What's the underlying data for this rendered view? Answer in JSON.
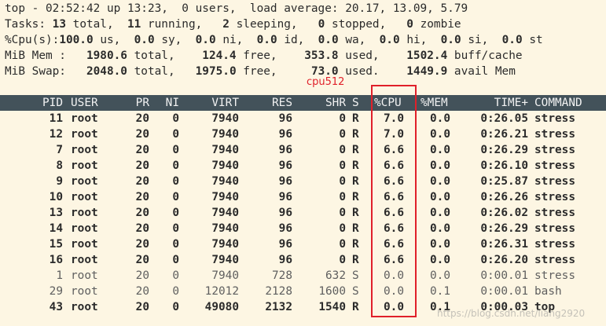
{
  "summary": {
    "line1": "top - 02:52:42 up 13:23,  0 users,  load average: 20.17, 13.09, 5.79",
    "tasks": {
      "label": "Tasks:",
      "total": "13",
      "total_lbl": "total,",
      "running": "11",
      "running_lbl": "running,",
      "sleeping": "2",
      "sleeping_lbl": "sleeping,",
      "stopped": "0",
      "stopped_lbl": "stopped,",
      "zombie": "0",
      "zombie_lbl": "zombie"
    },
    "cpu": {
      "label": "%Cpu(s):",
      "us": "100.0",
      "us_lbl": "us,",
      "sy": "0.0",
      "sy_lbl": "sy,",
      "ni": "0.0",
      "ni_lbl": "ni,",
      "id": "0.0",
      "id_lbl": "id,",
      "wa": "0.0",
      "wa_lbl": "wa,",
      "hi": "0.0",
      "hi_lbl": "hi,",
      "si": "0.0",
      "si_lbl": "si,",
      "st": "0.0",
      "st_lbl": "st"
    },
    "mem": {
      "label": "MiB Mem :",
      "total": "1980.6",
      "total_lbl": "total,",
      "free": "124.4",
      "free_lbl": "free,",
      "used": "353.8",
      "used_lbl": "used,",
      "buff": "1502.4",
      "buff_lbl": "buff/cache"
    },
    "swap": {
      "label": "MiB Swap:",
      "total": "2048.0",
      "total_lbl": "total,",
      "free": "1975.0",
      "free_lbl": "free,",
      "used": "73.0",
      "used_lbl": "used.",
      "avail": "1449.9",
      "avail_lbl": "avail Mem"
    }
  },
  "annotation": "cpu512",
  "columns": [
    "PID",
    "USER",
    "PR",
    "NI",
    "VIRT",
    "RES",
    "SHR",
    "S",
    "%CPU",
    "%MEM",
    "TIME+",
    "COMMAND"
  ],
  "processes": [
    {
      "pid": "11",
      "user": "root",
      "pr": "20",
      "ni": "0",
      "virt": "7940",
      "res": "96",
      "shr": "0",
      "s": "R",
      "cpu": "7.0",
      "mem": "0.0",
      "time": "0:26.05",
      "cmd": "stress",
      "bold": true
    },
    {
      "pid": "12",
      "user": "root",
      "pr": "20",
      "ni": "0",
      "virt": "7940",
      "res": "96",
      "shr": "0",
      "s": "R",
      "cpu": "7.0",
      "mem": "0.0",
      "time": "0:26.21",
      "cmd": "stress",
      "bold": true
    },
    {
      "pid": "7",
      "user": "root",
      "pr": "20",
      "ni": "0",
      "virt": "7940",
      "res": "96",
      "shr": "0",
      "s": "R",
      "cpu": "6.6",
      "mem": "0.0",
      "time": "0:26.29",
      "cmd": "stress",
      "bold": true
    },
    {
      "pid": "8",
      "user": "root",
      "pr": "20",
      "ni": "0",
      "virt": "7940",
      "res": "96",
      "shr": "0",
      "s": "R",
      "cpu": "6.6",
      "mem": "0.0",
      "time": "0:26.10",
      "cmd": "stress",
      "bold": true
    },
    {
      "pid": "9",
      "user": "root",
      "pr": "20",
      "ni": "0",
      "virt": "7940",
      "res": "96",
      "shr": "0",
      "s": "R",
      "cpu": "6.6",
      "mem": "0.0",
      "time": "0:25.87",
      "cmd": "stress",
      "bold": true
    },
    {
      "pid": "10",
      "user": "root",
      "pr": "20",
      "ni": "0",
      "virt": "7940",
      "res": "96",
      "shr": "0",
      "s": "R",
      "cpu": "6.6",
      "mem": "0.0",
      "time": "0:26.26",
      "cmd": "stress",
      "bold": true
    },
    {
      "pid": "13",
      "user": "root",
      "pr": "20",
      "ni": "0",
      "virt": "7940",
      "res": "96",
      "shr": "0",
      "s": "R",
      "cpu": "6.6",
      "mem": "0.0",
      "time": "0:26.02",
      "cmd": "stress",
      "bold": true
    },
    {
      "pid": "14",
      "user": "root",
      "pr": "20",
      "ni": "0",
      "virt": "7940",
      "res": "96",
      "shr": "0",
      "s": "R",
      "cpu": "6.6",
      "mem": "0.0",
      "time": "0:26.29",
      "cmd": "stress",
      "bold": true
    },
    {
      "pid": "15",
      "user": "root",
      "pr": "20",
      "ni": "0",
      "virt": "7940",
      "res": "96",
      "shr": "0",
      "s": "R",
      "cpu": "6.6",
      "mem": "0.0",
      "time": "0:26.31",
      "cmd": "stress",
      "bold": true
    },
    {
      "pid": "16",
      "user": "root",
      "pr": "20",
      "ni": "0",
      "virt": "7940",
      "res": "96",
      "shr": "0",
      "s": "R",
      "cpu": "6.6",
      "mem": "0.0",
      "time": "0:26.20",
      "cmd": "stress",
      "bold": true
    },
    {
      "pid": "1",
      "user": "root",
      "pr": "20",
      "ni": "0",
      "virt": "7940",
      "res": "728",
      "shr": "632",
      "s": "S",
      "cpu": "0.0",
      "mem": "0.0",
      "time": "0:00.01",
      "cmd": "stress",
      "bold": false
    },
    {
      "pid": "29",
      "user": "root",
      "pr": "20",
      "ni": "0",
      "virt": "12012",
      "res": "2128",
      "shr": "1600",
      "s": "S",
      "cpu": "0.0",
      "mem": "0.1",
      "time": "0:00.01",
      "cmd": "bash",
      "bold": false
    },
    {
      "pid": "43",
      "user": "root",
      "pr": "20",
      "ni": "0",
      "virt": "49080",
      "res": "2132",
      "shr": "1540",
      "s": "R",
      "cpu": "0.0",
      "mem": "0.1",
      "time": "0:00.03",
      "cmd": "top",
      "bold": true
    }
  ],
  "watermark": "https://blog.csdn.net/liang2920",
  "colors": {
    "background": "#fdf6e3",
    "header_bar": "#43525a",
    "highlight_box": "#e0202a"
  }
}
